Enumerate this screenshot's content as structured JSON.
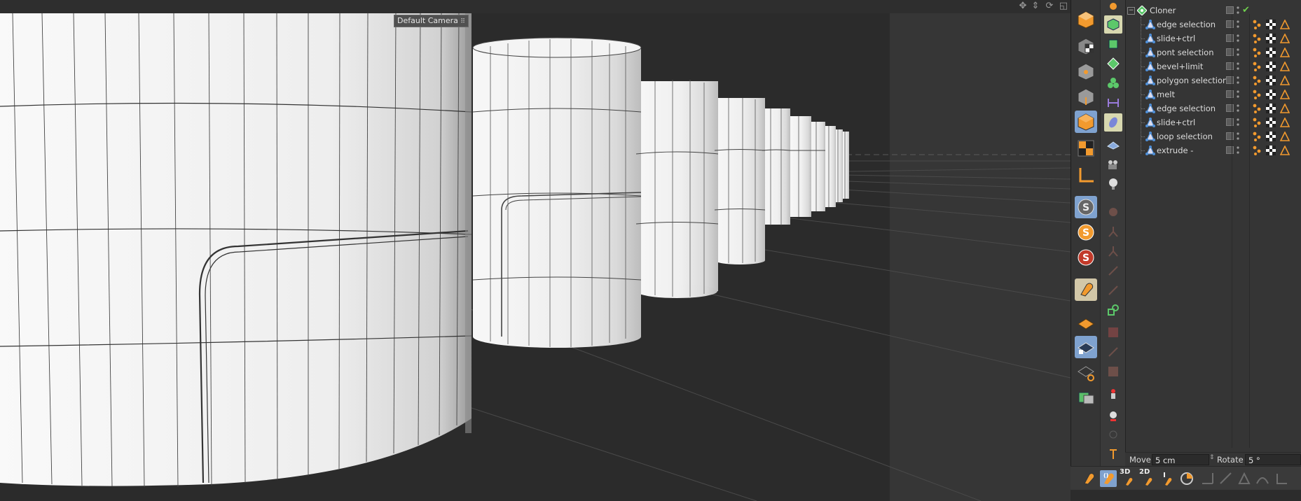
{
  "viewport": {
    "camera_label": "Default Camera",
    "camera_icon": "camera-dots-icon",
    "nav_icons": [
      "move-view-icon",
      "dolly-view-icon",
      "rotate-view-icon",
      "toggle-layout-icon"
    ]
  },
  "palette": {
    "left_tools": [
      "model-mode",
      "object-mode",
      "point-mode",
      "edge-mode",
      "polygon-mode",
      "uv-mode",
      "axis-mode",
      "solo-off",
      "solo-on",
      "solo-hierarchy",
      "snap-magnet",
      "workplane",
      "locked-workplane",
      "planar-workplane",
      "render-view"
    ],
    "right_tools": [
      "pen-tool",
      "cube-generator",
      "subdivision",
      "cloner-mograph",
      "mograph-effector",
      "deformer",
      "spline-sculpt",
      "floor-grid",
      "camera",
      "light",
      "brush",
      "tripod",
      "joint",
      "weight",
      "paint",
      "primitive",
      "texture",
      "stitch",
      "fill",
      "mocca",
      "pose-morph",
      "timeline"
    ]
  },
  "objects": {
    "root": {
      "name": "Cloner",
      "icon": "cloner-icon"
    },
    "items": [
      {
        "name": "edge selection"
      },
      {
        "name": "slide+ctrl"
      },
      {
        "name": "pont selection"
      },
      {
        "name": "bevel+limit"
      },
      {
        "name": "polygon selection"
      },
      {
        "name": "melt"
      },
      {
        "name": "edge selection"
      },
      {
        "name": "slide+ctrl"
      },
      {
        "name": "loop selection"
      },
      {
        "name": "extrude -"
      }
    ]
  },
  "coords": {
    "move_label": "Move",
    "move_value": "5 cm",
    "rotate_label": "Rotate",
    "rotate_value": "5 °"
  },
  "snap": {
    "label_3d": "3D",
    "label_2d": "2D"
  },
  "colors": {
    "accent_orange": "#f29a2e",
    "selection_blue": "#7fa2cf",
    "panel_bg": "#353535"
  }
}
